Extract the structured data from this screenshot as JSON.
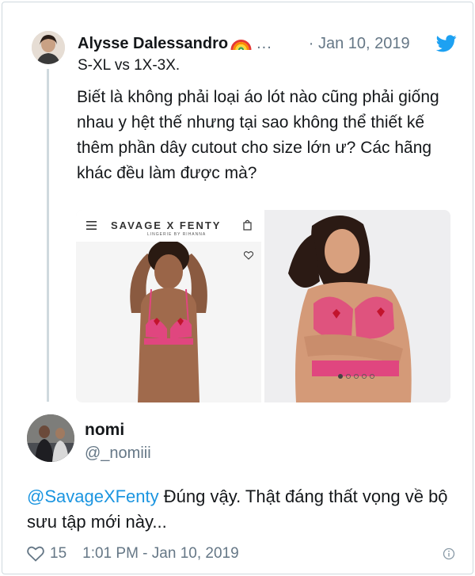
{
  "parent_tweet": {
    "author_name": "Alysse Dalessandro",
    "more": "...",
    "date": "· Jan 10, 2019",
    "reply_context": "S-XL vs 1X-3X.",
    "text": "Biết là không phải loại áo lót nào cũng phải giống nhau y hệt thế nhưng tại sao không thể thiết kế thêm phần dây cutout cho size lớn ư? Các hãng khác đều làm được mà?",
    "media": {
      "left": {
        "brand_name": "SAVAGE X FENTY",
        "brand_sub": "LINGERIE BY RIHANNA"
      }
    }
  },
  "reply_tweet": {
    "name": "nomi",
    "handle": "@_nomiii",
    "mention": "@SavageXFenty",
    "text": " Đúng vậy. Thật đáng thất vọng về bộ sưu tập mới này...",
    "like_count": "15",
    "timestamp": "1:01 PM - Jan 10, 2019"
  },
  "colors": {
    "twitter_blue": "#1da1f2",
    "link_blue": "#1b95e0",
    "muted_gray": "#657786",
    "bra_pink": "#e0467f"
  },
  "icons": {
    "rainbow": "rainbow-emoji-icon",
    "bird": "twitter-bird-icon",
    "heart": "heart-outline-icon",
    "info": "info-icon"
  }
}
